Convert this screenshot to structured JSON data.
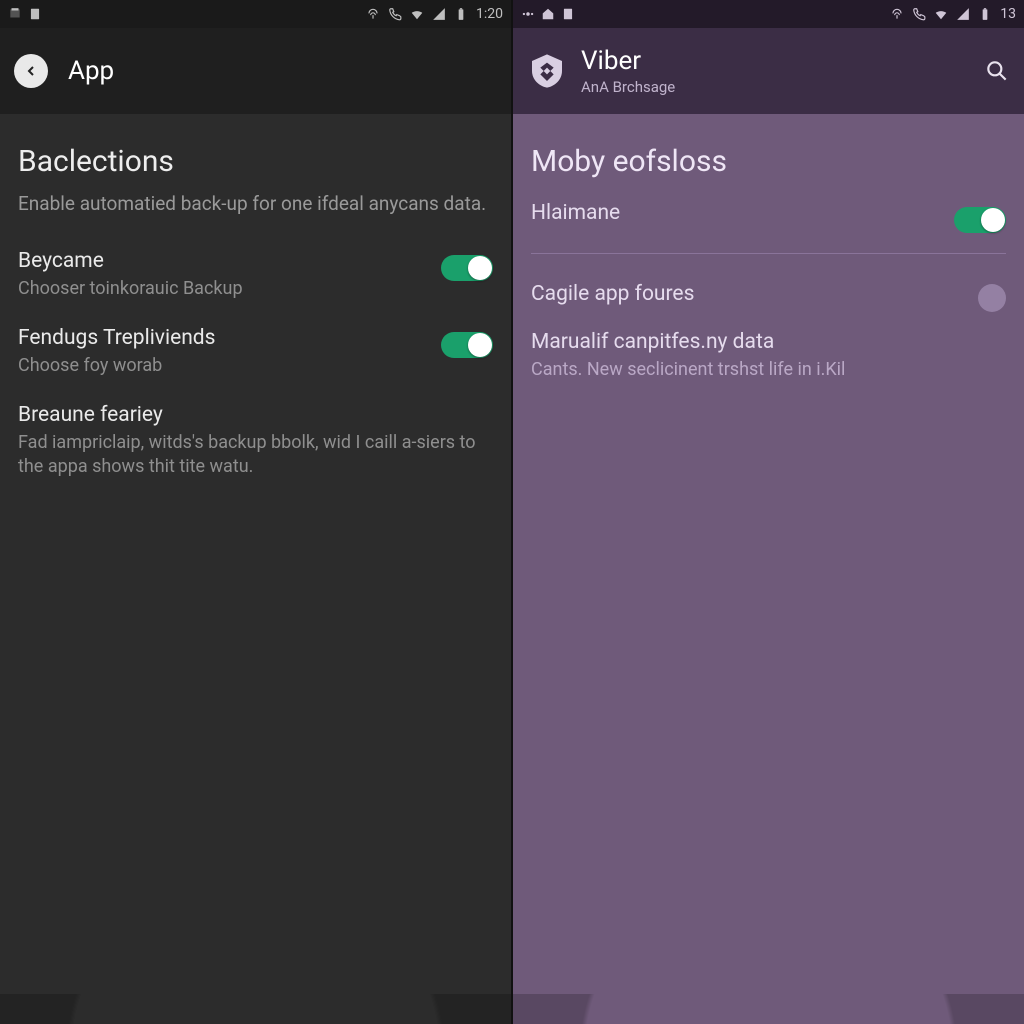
{
  "left": {
    "status": {
      "time": "1:20"
    },
    "appbar": {
      "title": "App"
    },
    "section": {
      "heading": "Baclections",
      "description": "Enable automatied back-up for one ifdeal anycans data."
    },
    "rows": [
      {
        "label": "Beycame",
        "sub": "Chooser toinkorauic Backup",
        "toggle": true
      },
      {
        "label": "Fendugs Trepliviends",
        "sub": "Choose foy worab",
        "toggle": true
      },
      {
        "label": "Breaune feariey",
        "sub": "Fad iampriclaip, witds's backup bbolk, wid I caill a-siers to the appa shows thit tite watu.",
        "toggle": null
      }
    ]
  },
  "right": {
    "status": {
      "time": "13"
    },
    "appbar": {
      "title": "Viber",
      "subtitle": "AnA Brchsage"
    },
    "section": {
      "heading": "Moby eofsloss"
    },
    "row_toggle": {
      "label": "Hlaimane",
      "toggle": true
    },
    "row_radio": {
      "label": "Cagile app foures"
    },
    "row_desc": {
      "label": "Marualif canpitfes.ny data",
      "sub": "Cants. New seclicinent trshst life in i.Kil"
    }
  }
}
